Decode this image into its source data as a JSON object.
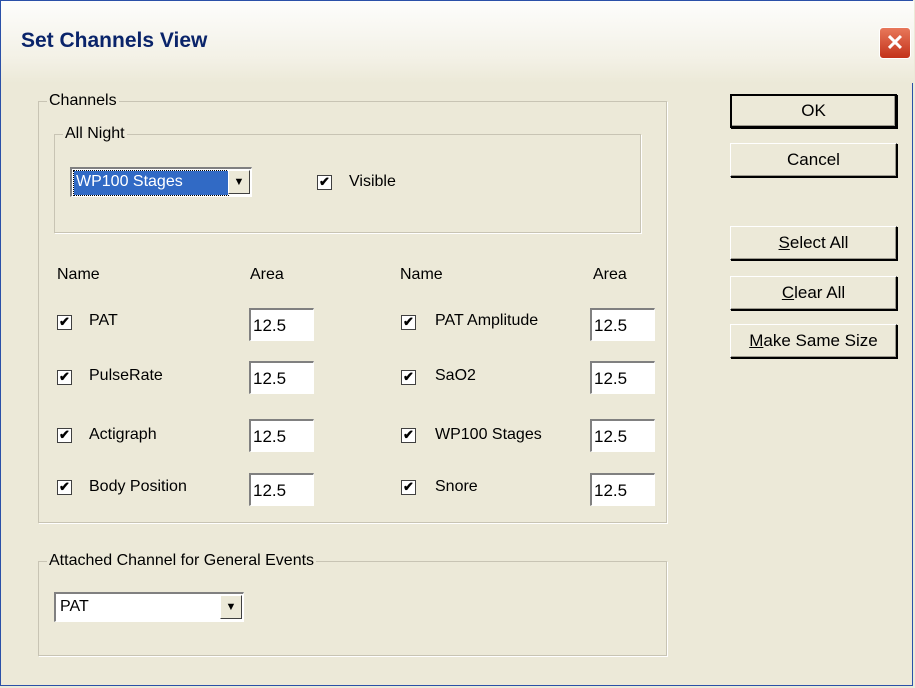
{
  "window": {
    "title": "Set Channels View",
    "close_glyph": "✕"
  },
  "channels_group": {
    "label": "Channels"
  },
  "all_night": {
    "label": "All Night",
    "combo_value": "WP100 Stages",
    "visible_label": "Visible",
    "visible_checked": true
  },
  "headers": {
    "name": "Name",
    "area": "Area"
  },
  "left_channels": [
    {
      "name": "PAT",
      "checked": true,
      "area": "12.5"
    },
    {
      "name": "PulseRate",
      "checked": true,
      "area": "12.5"
    },
    {
      "name": "Actigraph",
      "checked": true,
      "area": "12.5"
    },
    {
      "name": "Body Position",
      "checked": true,
      "area": "12.5"
    }
  ],
  "right_channels": [
    {
      "name": "PAT Amplitude",
      "checked": true,
      "area": "12.5"
    },
    {
      "name": "SaO2",
      "checked": true,
      "area": "12.5"
    },
    {
      "name": "WP100 Stages",
      "checked": true,
      "area": "12.5"
    },
    {
      "name": "Snore",
      "checked": true,
      "area": "12.5"
    }
  ],
  "attached": {
    "label": "Attached Channel for General Events",
    "combo_value": "PAT"
  },
  "buttons": {
    "ok": "OK",
    "cancel": "Cancel",
    "select_all": {
      "mnemonic": "S",
      "rest": "elect All"
    },
    "clear_all": {
      "mnemonic": "C",
      "rest": "lear All"
    },
    "make_same_size": {
      "mnemonic": "M",
      "rest": "ake Same Size"
    }
  },
  "icons": {
    "check": "check-icon",
    "dropdown": "chevron-down-icon",
    "close": "close-icon"
  }
}
